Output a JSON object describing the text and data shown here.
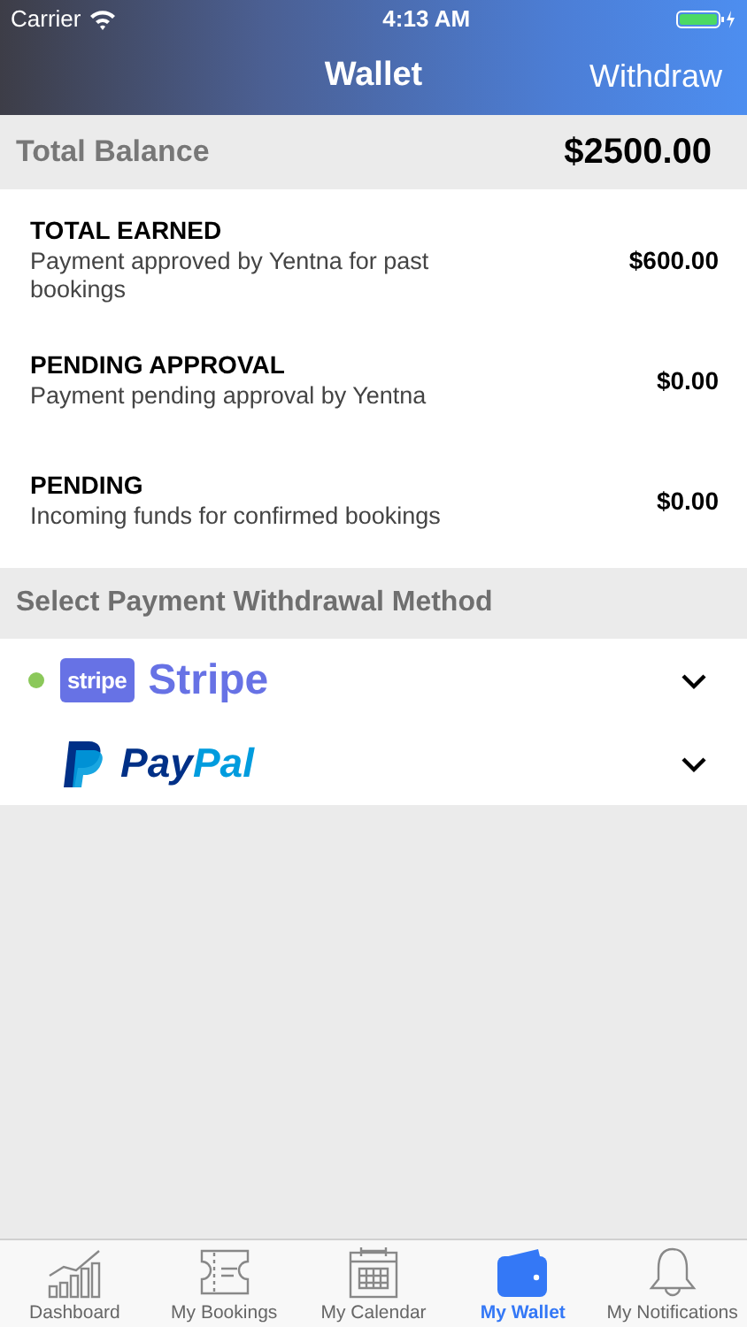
{
  "status_bar": {
    "carrier": "Carrier",
    "time": "4:13 AM"
  },
  "nav": {
    "title": "Wallet",
    "action": "Withdraw"
  },
  "balance": {
    "label": "Total Balance",
    "amount": "$2500.00"
  },
  "entries": [
    {
      "title": "TOTAL EARNED",
      "description": "Payment approved by Yentna for past bookings",
      "amount": "$600.00"
    },
    {
      "title": "PENDING APPROVAL",
      "description": "Payment pending approval by Yentna",
      "amount": "$0.00"
    },
    {
      "title": "PENDING",
      "description": "Incoming funds for confirmed bookings",
      "amount": "$0.00"
    }
  ],
  "methods_header": "Select Payment Withdrawal Method",
  "methods": [
    {
      "kind": "stripe",
      "logo_text": "stripe",
      "name_parts": [
        "Stripe"
      ],
      "selected": true
    },
    {
      "kind": "paypal",
      "name_parts": [
        "Pay",
        "Pal"
      ],
      "selected": false
    }
  ],
  "tabs": [
    {
      "label": "Dashboard",
      "selected": false
    },
    {
      "label": "My Bookings",
      "selected": false
    },
    {
      "label": "My Calendar",
      "selected": false
    },
    {
      "label": "My Wallet",
      "selected": true
    },
    {
      "label": "My Notifications",
      "selected": false
    }
  ]
}
